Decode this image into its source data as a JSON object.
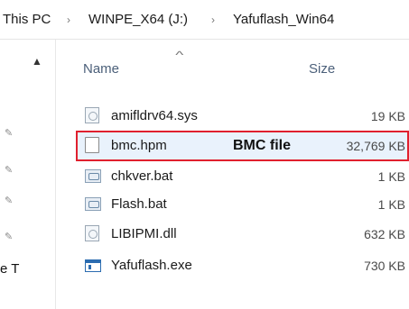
{
  "breadcrumb": {
    "items": [
      "This PC",
      "WINPE_X64 (J:)",
      "Yafuflash_Win64"
    ],
    "separator": "›"
  },
  "nav_pane": {
    "partial_label": "e T"
  },
  "columns": {
    "name": "Name",
    "size": "Size"
  },
  "files": [
    {
      "name": "amifldrv64.sys",
      "size": "19 KB",
      "icon": "system-file-icon"
    },
    {
      "name": "bmc.hpm",
      "size": "32,769 KB",
      "icon": "generic-file-icon"
    },
    {
      "name": "chkver.bat",
      "size": "1 KB",
      "icon": "batch-file-icon"
    },
    {
      "name": "Flash.bat",
      "size": "1 KB",
      "icon": "batch-file-icon"
    },
    {
      "name": "LIBIPMI.dll",
      "size": "632 KB",
      "icon": "system-file-icon"
    },
    {
      "name": "Yafuflash.exe",
      "size": "730 KB",
      "icon": "application-icon"
    }
  ],
  "annotation": {
    "label": "BMC file",
    "highlight_color": "#e0202e"
  }
}
